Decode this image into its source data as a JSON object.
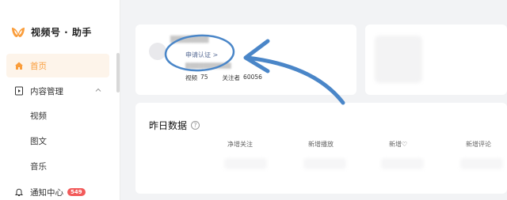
{
  "app": {
    "logo_text": "视频号 · 助手",
    "accent_color": "#fa9d3b",
    "brand_icon": "butterfly-logo-icon"
  },
  "sidebar": {
    "items": [
      {
        "label": "首页",
        "icon": "home-icon",
        "active": true
      },
      {
        "label": "内容管理",
        "icon": "content-icon",
        "expanded": true
      },
      {
        "label": "视频"
      },
      {
        "label": "图文"
      },
      {
        "label": "音乐"
      },
      {
        "label": "通知中心",
        "icon": "bell-icon",
        "badge": "549"
      }
    ]
  },
  "profile": {
    "verify_link": "申请认证 >",
    "stats": {
      "video_label": "视频",
      "video_count": "75",
      "followers_label": "关注者",
      "followers_count": "60056"
    }
  },
  "yesterday": {
    "title": "昨日数据",
    "help_icon": "question-circle-icon",
    "metrics": [
      {
        "label": "净增关注"
      },
      {
        "label": "新增播放"
      },
      {
        "label": "新增♡"
      },
      {
        "label": "新增评论"
      }
    ]
  },
  "annotation": {
    "color": "#4a86c8"
  }
}
